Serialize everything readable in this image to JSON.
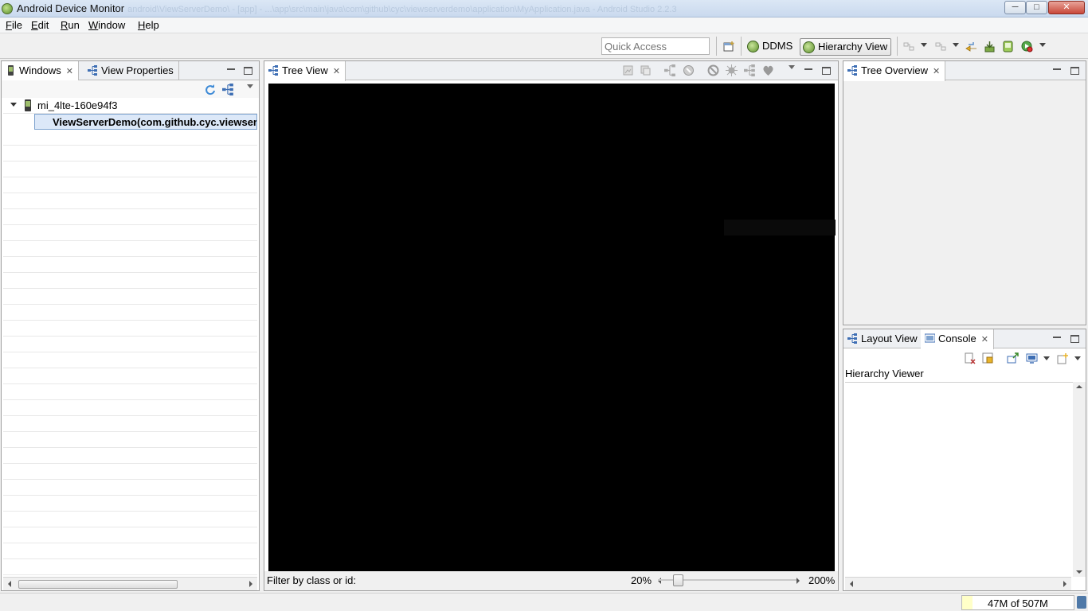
{
  "window": {
    "title": "Android Device Monitor",
    "path": "android\\ViewServerDemo\\ - [app] - ...\\app\\src\\main\\java\\com\\github\\cyc\\viewserverdemo\\application\\MyApplication.java - Android Studio 2.2.3",
    "min_glyph": "─",
    "max_glyph": "□",
    "close_glyph": "✕"
  },
  "menu": [
    "File",
    "Edit",
    "Run",
    "Window",
    "Help"
  ],
  "toolbar": {
    "quick_access_placeholder": "Quick Access",
    "perspectives": [
      {
        "label": "DDMS",
        "active": false
      },
      {
        "label": "Hierarchy View",
        "active": true
      }
    ]
  },
  "windows_panel": {
    "tabs": [
      {
        "label": "Windows",
        "icon": "device-icon",
        "closable": true,
        "active": true
      },
      {
        "label": "View Properties",
        "icon": "hierarchy-icon",
        "closable": false,
        "active": false
      }
    ],
    "device": "mi_4lte-160e94f3",
    "window_item": "ViewServerDemo(com.github.cyc.viewserverdemo/com.github.cyc.viewserverdemo.MainActivity)"
  },
  "tree_view": {
    "tab_label": "Tree View",
    "filter_label": "Filter by class or id:",
    "filter_value": "",
    "zoom_min": "20%",
    "zoom_max": "200%",
    "zoom_fraction": 0.08
  },
  "tree_overview": {
    "tab_label": "Tree Overview"
  },
  "bottom_right": {
    "tabs": [
      {
        "label": "Layout View",
        "active": false
      },
      {
        "label": "Console",
        "active": true
      }
    ],
    "console_title": "Hierarchy Viewer"
  },
  "status": {
    "heap": "47M of 507M",
    "heap_fraction": 0.093
  },
  "colors": {
    "accent": "#3d6eb4",
    "canvas": "#000000",
    "selection": "#dce8f8"
  }
}
